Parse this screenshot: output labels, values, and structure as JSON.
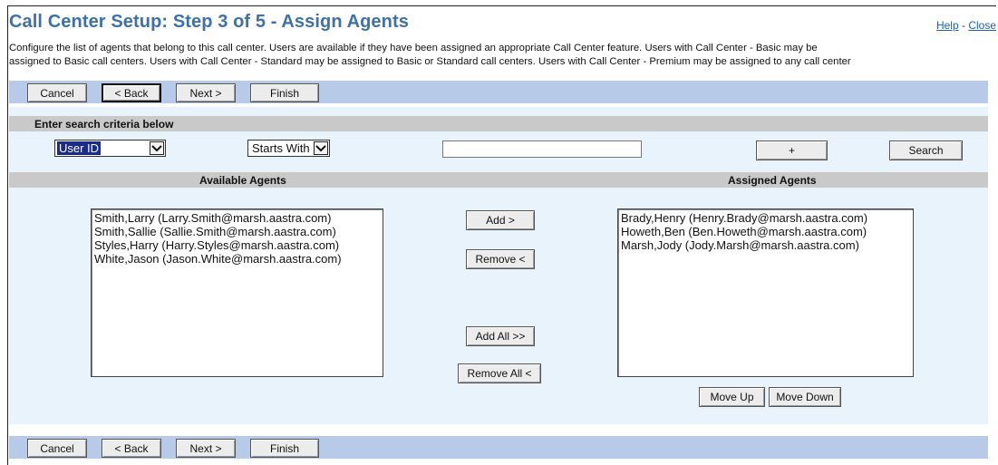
{
  "header": {
    "title": "Call Center Setup: Step 3 of 5 - Assign Agents",
    "help_link": "Help",
    "separator": "-",
    "close_link": "Close"
  },
  "description": {
    "line1": "Configure the list of agents that belong to this call center. Users are available if they have been assigned an appropriate Call Center feature. Users with Call Center - Basic may be",
    "line2": "assigned to Basic call centers. Users with Call Center - Standard may be assigned to Basic or Standard call centers. Users with Call Center - Premium may be assigned to any call center"
  },
  "buttons": {
    "cancel": "Cancel",
    "back": "< Back",
    "next": "Next >",
    "finish": "Finish"
  },
  "search": {
    "header": "Enter search criteria below",
    "field_select": "User ID",
    "mode_select": "Starts With",
    "text_value": "",
    "plus_button": "+",
    "search_button": "Search"
  },
  "available": {
    "header": "Available Agents",
    "items": [
      "Smith,Larry (Larry.Smith@marsh.aastra.com)",
      "Smith,Sallie (Sallie.Smith@marsh.aastra.com)",
      "Styles,Harry (Harry.Styles@marsh.aastra.com)",
      "White,Jason (Jason.White@marsh.aastra.com)"
    ]
  },
  "assigned": {
    "header": "Assigned Agents",
    "items": [
      "Brady,Henry (Henry.Brady@marsh.aastra.com)",
      "Howeth,Ben (Ben.Howeth@marsh.aastra.com)",
      "Marsh,Jody (Jody.Marsh@marsh.aastra.com)"
    ]
  },
  "transfer": {
    "add": "Add >",
    "remove": "Remove <",
    "add_all": "Add All >>",
    "remove_all": "Remove All <"
  },
  "ordering": {
    "move_up": "Move Up",
    "move_down": "Move Down"
  },
  "colors": {
    "title": "#3e71a8",
    "button_bar": "#b7cbe9",
    "panel": "#e9f3fb",
    "section_bar": "#c9c9c9",
    "select_highlight": "#1b2b8a",
    "link": "#1f5fb4"
  },
  "icons": {
    "dropdown": "chevron-down-icon"
  }
}
